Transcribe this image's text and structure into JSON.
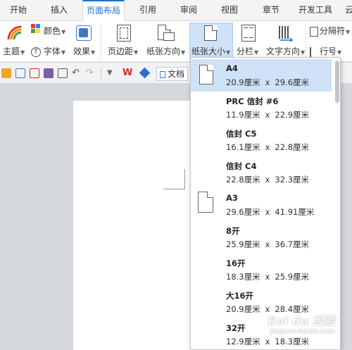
{
  "tabs": [
    "开始",
    "插入",
    "页面布局",
    "引用",
    "审阅",
    "视图",
    "章节",
    "开发工具",
    "云"
  ],
  "active_tab_index": 2,
  "ribbon": {
    "theme": "主题",
    "color": "颜色",
    "font": "字体",
    "effects": "效果",
    "margins": "页边距",
    "orientation": "纸张方向",
    "size": "纸张大小",
    "columns": "分栏",
    "text_direction": "文字方向",
    "separator": "分隔符",
    "line_numbers": "行号"
  },
  "quickbar": {
    "doc_tab": "文档"
  },
  "paper_sizes": [
    {
      "name": "A4",
      "w": "20.9厘米",
      "x": "x",
      "h": "29.6厘米",
      "icon": true,
      "selected": true
    },
    {
      "name": "PRC 信封 #6",
      "w": "11.9厘米",
      "x": "x",
      "h": "22.9厘米",
      "icon": false,
      "selected": false
    },
    {
      "name": "信封 C5",
      "w": "16.1厘米",
      "x": "x",
      "h": "22.8厘米",
      "icon": false,
      "selected": false
    },
    {
      "name": "信封 C4",
      "w": "22.8厘米",
      "x": "x",
      "h": "32.3厘米",
      "icon": false,
      "selected": false
    },
    {
      "name": "A3",
      "w": "29.6厘米",
      "x": "x",
      "h": "41.91厘米",
      "icon": true,
      "selected": false
    },
    {
      "name": "8开",
      "w": "25.9厘米",
      "x": "x",
      "h": "36.7厘米",
      "icon": false,
      "selected": false
    },
    {
      "name": "16开",
      "w": "18.3厘米",
      "x": "x",
      "h": "25.9厘米",
      "icon": false,
      "selected": false
    },
    {
      "name": "大16开",
      "w": "20.9厘米",
      "x": "x",
      "h": "28.4厘米",
      "icon": false,
      "selected": false
    },
    {
      "name": "32开",
      "w": "12.9厘米",
      "x": "x",
      "h": "18.3厘米",
      "icon": false,
      "selected": false
    }
  ],
  "watermark": {
    "text": "Bai du 经验",
    "sub": "jingyan.baidu.com"
  },
  "colors": {
    "accent": "#1f6fd0",
    "selected_bg": "#cfe2f8"
  }
}
